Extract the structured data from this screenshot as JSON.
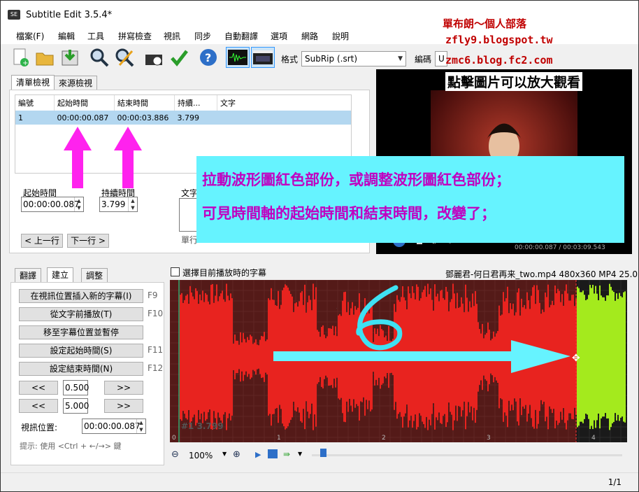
{
  "app": {
    "title": "Subtitle Edit 3.5.4*",
    "icon": "SE"
  },
  "menu": [
    "檔案(F)",
    "編輯",
    "工具",
    "拼寫檢查",
    "視訊",
    "同步",
    "自動翻譯",
    "選項",
    "網路",
    "說明"
  ],
  "toolbar": {
    "format_label": "格式",
    "format_value": "SubRip (.srt)",
    "encoding_label": "編碼",
    "encoding_value": "U"
  },
  "list_tabs": [
    "清單檢視",
    "來源檢視"
  ],
  "table": {
    "headers": [
      "編號",
      "起始時間",
      "結束時間",
      "持續...",
      "文字"
    ],
    "rows": [
      [
        "1",
        "00:00:00.087",
        "00:00:03.886",
        "3.799",
        ""
      ]
    ]
  },
  "edit": {
    "start_label": "起始時間",
    "start_value": "00:00:00.087",
    "duration_label": "持續時間",
    "duration_value": "3.799",
    "text_label": "文字",
    "single_line_label": "單行",
    "prev_button": "< 上一行",
    "next_button": "下一行 >"
  },
  "video": {
    "time": "00:00:00.087 / 00:03:09.543"
  },
  "lower_tabs": [
    "翻譯",
    "建立",
    "調整"
  ],
  "create_buttons": [
    {
      "label": "在視訊位置插入新的字幕(I)",
      "key": "F9"
    },
    {
      "label": "從文字前播放(T)",
      "key": "F10"
    },
    {
      "label": "移至字幕位置並暫停",
      "key": ""
    },
    {
      "label": "設定起始時間(S)",
      "key": "F11"
    },
    {
      "label": "設定結束時間(N)",
      "key": "F12"
    }
  ],
  "nudge": [
    {
      "left": "<<",
      "value": "0.500",
      "right": ">>"
    },
    {
      "left": "<<",
      "value": "5.000",
      "right": ">>"
    }
  ],
  "video_position_label": "視訊位置:",
  "video_position_value": "00:00:00.087",
  "hint": "提示: 使用 <Ctrl + ←/→> 鍵",
  "waveform": {
    "checkbox_label": "選擇目前播放時的字幕",
    "file_info": "鄧麗君-何日君再来_two.mp4 480x360 MP4 25.0",
    "subtitle_tag": "#1  3.799",
    "ticks": [
      "0",
      "1",
      "2",
      "3",
      "4"
    ],
    "zoom": "100%",
    "selection_color": "#e8231f",
    "other_color": "#a4ea1d",
    "background": "#1a1a1a"
  },
  "status": {
    "count": "1/1"
  },
  "overlay": {
    "blog_lines": [
      "單布朗～個人部落",
      "zfly9.blogspot.tw",
      "zmc6.blog.fc2.com",
      "點擊圖片可以放大觀看"
    ],
    "callout_lines": [
      "拉動波形圖紅色部份，或調整波形圖紅色部份；",
      "可見時間軸的起始時間和結束時間，改變了；"
    ],
    "number": "6"
  }
}
